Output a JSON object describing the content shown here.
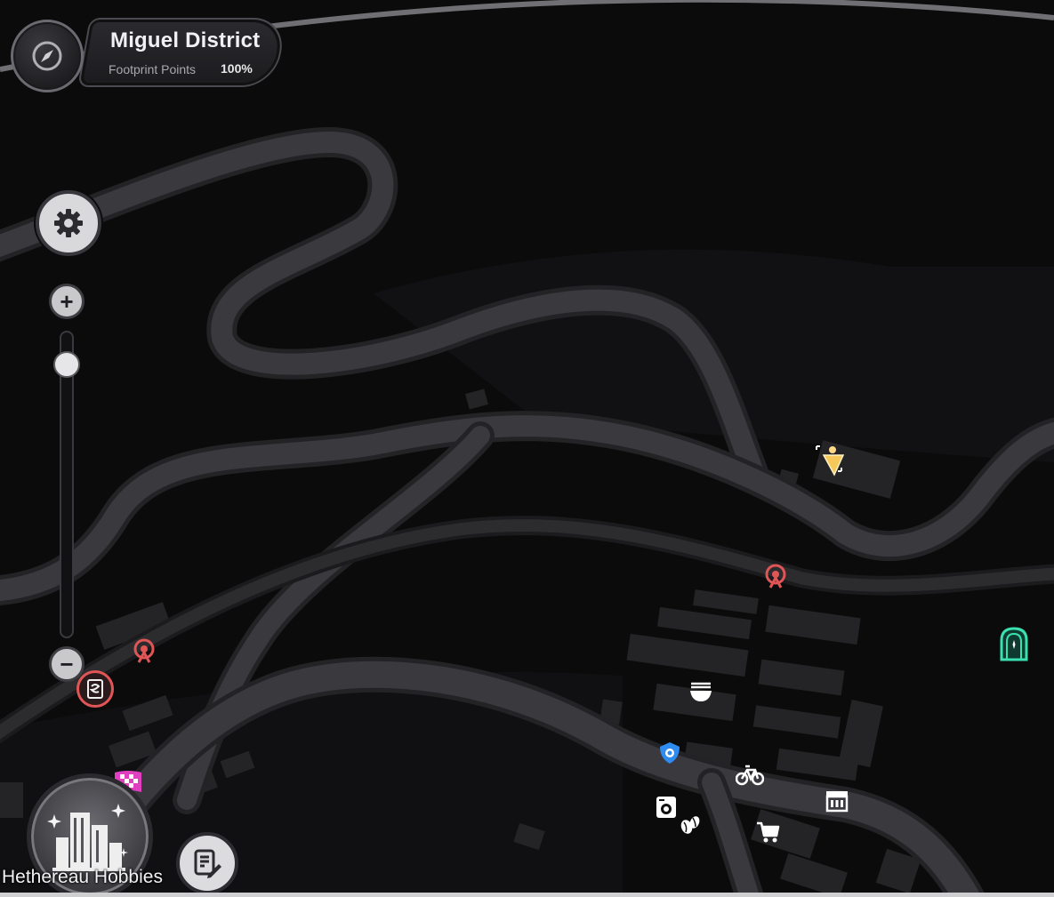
{
  "header": {
    "district_name": "Miguel District",
    "footprint_label": "Footprint Points",
    "footprint_value": "100%"
  },
  "controls": {
    "settings_icon": "gear-icon",
    "zoom_in_icon": "plus-icon",
    "zoom_out_icon": "minus-icon",
    "zoom_in_symbol": "+",
    "zoom_out_symbol": "−",
    "zoom_level_fraction": 0.1
  },
  "bottom": {
    "hobbies_label": "Hethereau Hobbies",
    "hobbies_icon": "city-buildings-icon",
    "notes_icon": "notes-edit-icon"
  },
  "markers": [
    {
      "name": "player-location-marker",
      "icon": "arrow-cone-icon",
      "color": "#f6c85a"
    },
    {
      "name": "fast-travel-marker-1",
      "icon": "tower-icon",
      "color": "#e05555"
    },
    {
      "name": "fast-travel-marker-2",
      "icon": "tower-icon",
      "color": "#e05555"
    },
    {
      "name": "vending-marker",
      "icon": "vending-machine-icon",
      "color": "#e05555"
    },
    {
      "name": "noodle-shop-marker",
      "icon": "noodle-bowl-icon",
      "color": "#ffffff"
    },
    {
      "name": "police-badge-marker",
      "icon": "police-badge-icon",
      "color": "#2f8bef"
    },
    {
      "name": "bike-rental-marker",
      "icon": "bicycle-icon",
      "color": "#ffffff"
    },
    {
      "name": "laundry-marker",
      "icon": "washing-machine-icon",
      "color": "#ffffff"
    },
    {
      "name": "coffee-marker",
      "icon": "coffee-beans-icon",
      "color": "#ffffff"
    },
    {
      "name": "shopping-cart-marker",
      "icon": "shopping-cart-icon",
      "color": "#ffffff"
    },
    {
      "name": "store-marker",
      "icon": "storefront-icon",
      "color": "#ffffff"
    },
    {
      "name": "portal-door-marker",
      "icon": "teal-door-icon",
      "color": "#3be0b0"
    },
    {
      "name": "checkered-flag-marker",
      "icon": "checkered-flag-icon",
      "color": "#e040c0"
    }
  ],
  "colors": {
    "background": "#0b0b0c",
    "road": "#3a393e",
    "road_edge": "#232326",
    "railway": "#2a2a2d",
    "building": "#242426"
  }
}
